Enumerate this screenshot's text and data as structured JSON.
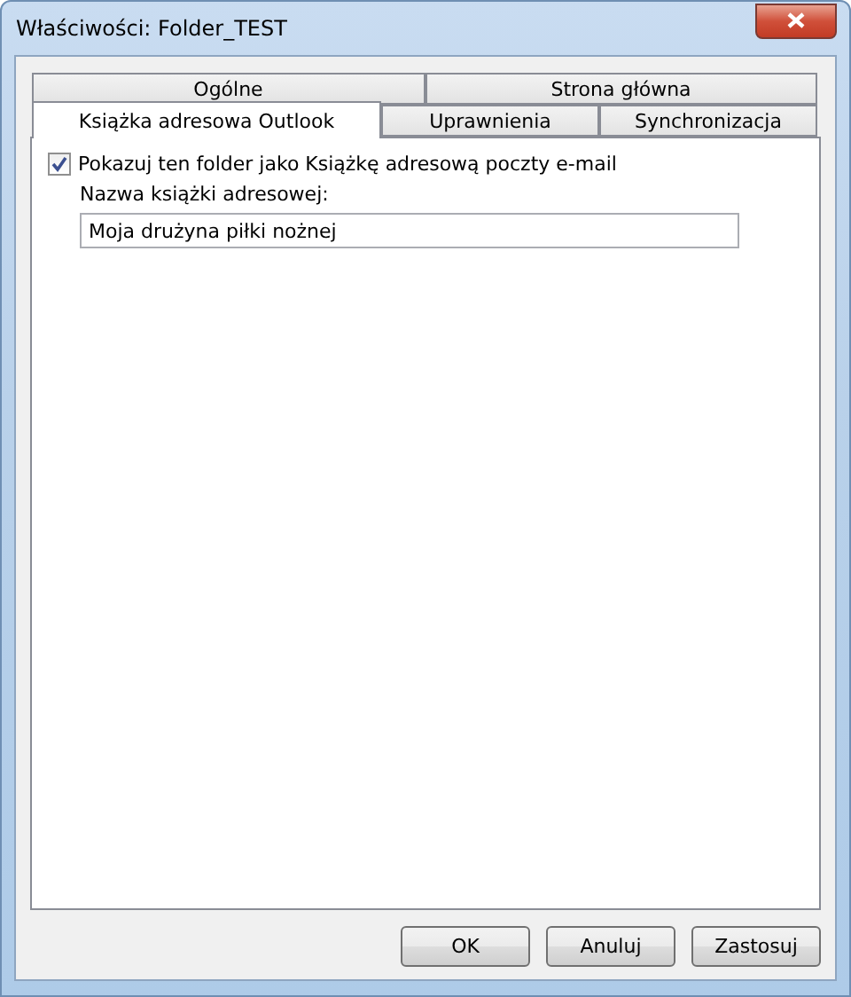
{
  "window": {
    "title": "Właściwości: Folder_TEST"
  },
  "tab_rows": [
    [
      {
        "label": "Ogólne",
        "selected": false
      },
      {
        "label": "Strona główna",
        "selected": false
      }
    ],
    [
      {
        "label": "Książka adresowa Outlook",
        "selected": true
      },
      {
        "label": "Uprawnienia",
        "selected": false
      },
      {
        "label": "Synchronizacja",
        "selected": false
      }
    ]
  ],
  "checkbox": {
    "label": "Pokazuj ten folder jako Książkę adresową poczty e-mail",
    "checked": true
  },
  "name_field": {
    "label": "Nazwa książki adresowej:",
    "value": "Moja drużyna piłki nożnej"
  },
  "buttons": [
    "OK",
    "Anuluj",
    "Zastosuj"
  ]
}
